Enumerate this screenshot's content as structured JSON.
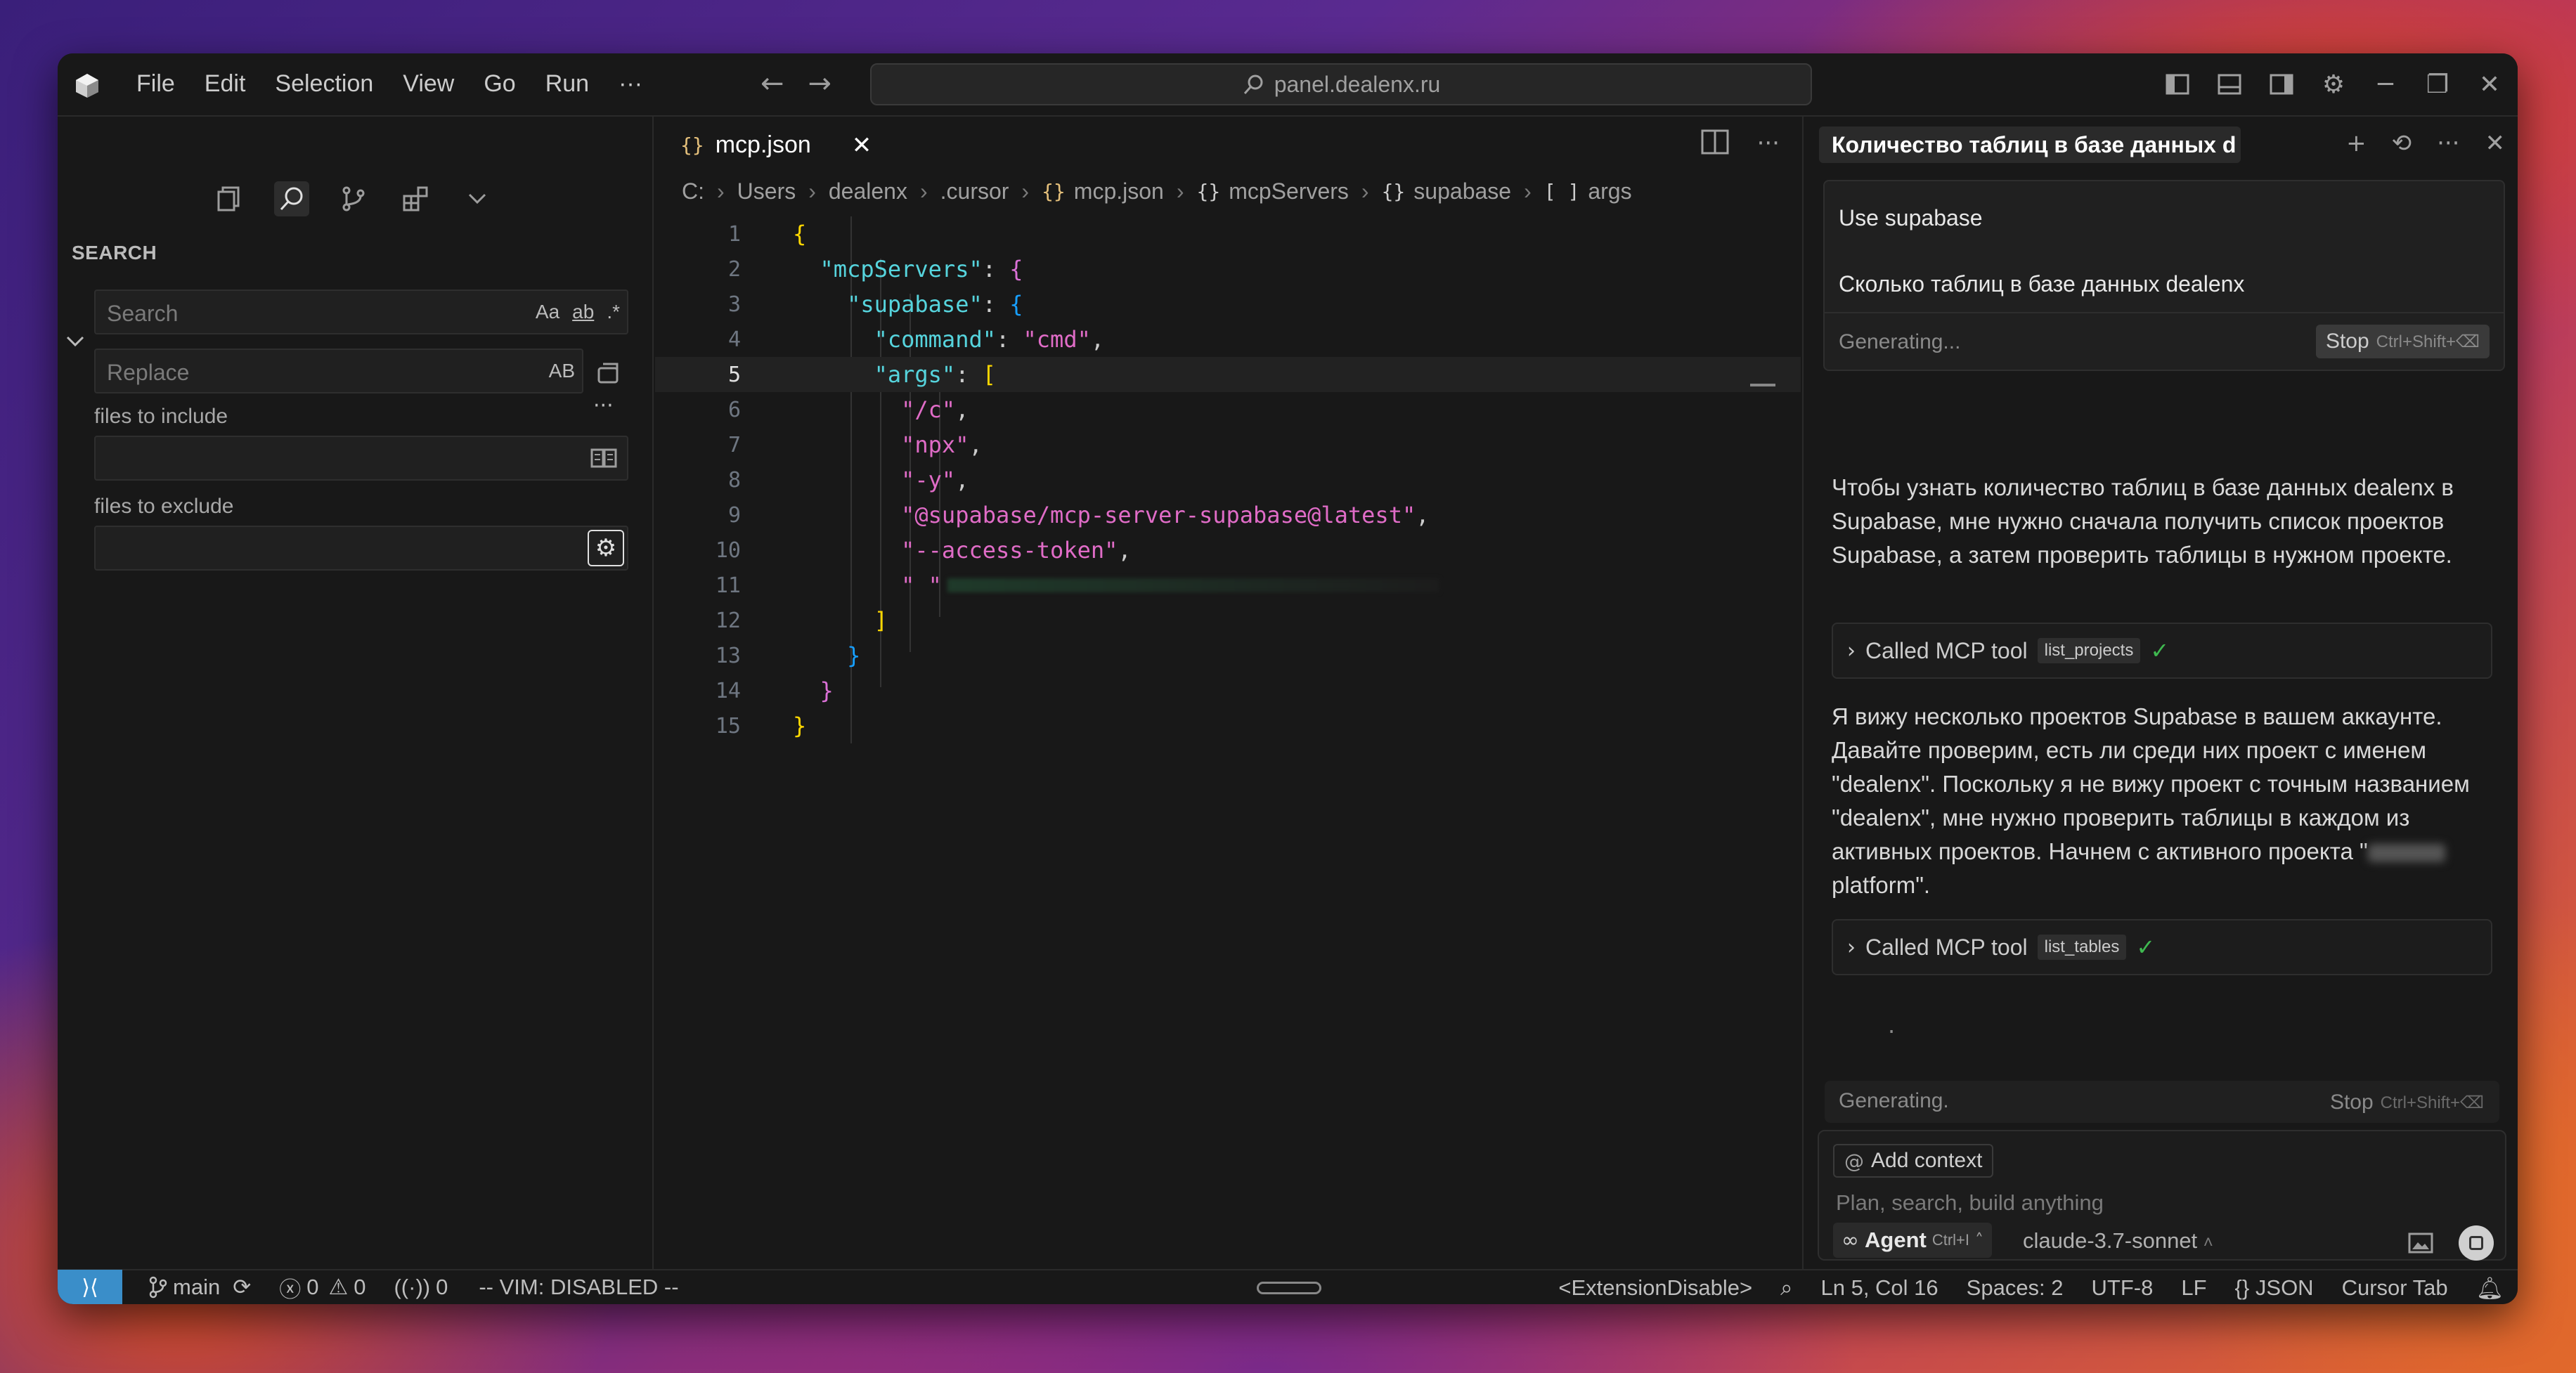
{
  "titlebar": {
    "menu": [
      "File",
      "Edit",
      "Selection",
      "View",
      "Go",
      "Run",
      "···"
    ],
    "command_center": "panel.dealenx.ru"
  },
  "sidebar": {
    "title": "SEARCH",
    "search_placeholder": "Search",
    "replace_placeholder": "Replace",
    "opt_case": "Aa",
    "opt_word": "ab",
    "opt_regex": ".*",
    "opt_preserve_case": "AB",
    "more": "···",
    "files_include_label": "files to include",
    "files_exclude_label": "files to exclude"
  },
  "editor": {
    "tab_name": "mcp.json",
    "breadcrumb": [
      "C:",
      "Users",
      "dealenx",
      ".cursor",
      "mcp.json",
      "mcpServers",
      "supabase",
      "args"
    ],
    "line_numbers": [
      "1",
      "2",
      "3",
      "4",
      "5",
      "6",
      "7",
      "8",
      "9",
      "10",
      "11",
      "12",
      "13",
      "14",
      "15"
    ],
    "code": {
      "l2_key": "\"mcpServers\"",
      "l3_key": "\"supabase\"",
      "l4_key": "\"command\"",
      "l4_val": "\"cmd\"",
      "l5_key": "\"args\"",
      "l6": "\"/c\"",
      "l7": "\"npx\"",
      "l8": "\"-y\"",
      "l9": "\"@supabase/mcp-server-supabase@latest\"",
      "l10": "\"--access-token\"",
      "l11": "\" \""
    }
  },
  "chat": {
    "tab_title": "Количество таблиц в базе данных d",
    "user_line1": "Use supabase",
    "user_line2": "Сколько таблиц в базе данных dealenx",
    "generating": "Generating...",
    "stop": "Stop",
    "stop_shortcut": "Ctrl+Shift+⌫",
    "para1": "Чтобы узнать количество таблиц в базе данных dealenx в Supabase, мне нужно сначала получить список проектов Supabase, а затем проверить таблицы в нужном проекте.",
    "tool1_label": "Called MCP tool",
    "tool1_name": "list_projects",
    "para2_a": "Я вижу несколько проектов Supabase в вашем аккаунте. Давайте проверим, есть ли среди них проект с именем \"dealenx\". Поскольку я не вижу проект с точным названием \"dealenx\", мне нужно проверить таблицы в каждом из активных проектов. Начнем с активного проекта \"",
    "para2_b": " platform\".",
    "tool2_label": "Called MCP tool",
    "tool2_name": "list_tables",
    "dot": ".",
    "generating2": "Generating.",
    "add_context": "Add context",
    "composer_placeholder": "Plan, search, build anything",
    "agent_label": "Agent",
    "agent_shortcut": "Ctrl+I",
    "model": "claude-3.7-sonnet"
  },
  "statusbar": {
    "branch": "main",
    "errors": "0",
    "warnings": "0",
    "ports": "0",
    "vim": "-- VIM: DISABLED --",
    "extension": "<ExtensionDisable>",
    "position": "Ln 5, Col 16",
    "spaces": "Spaces: 2",
    "encoding": "UTF-8",
    "eol": "LF",
    "language": "JSON",
    "cursor_tab": "Cursor Tab"
  }
}
